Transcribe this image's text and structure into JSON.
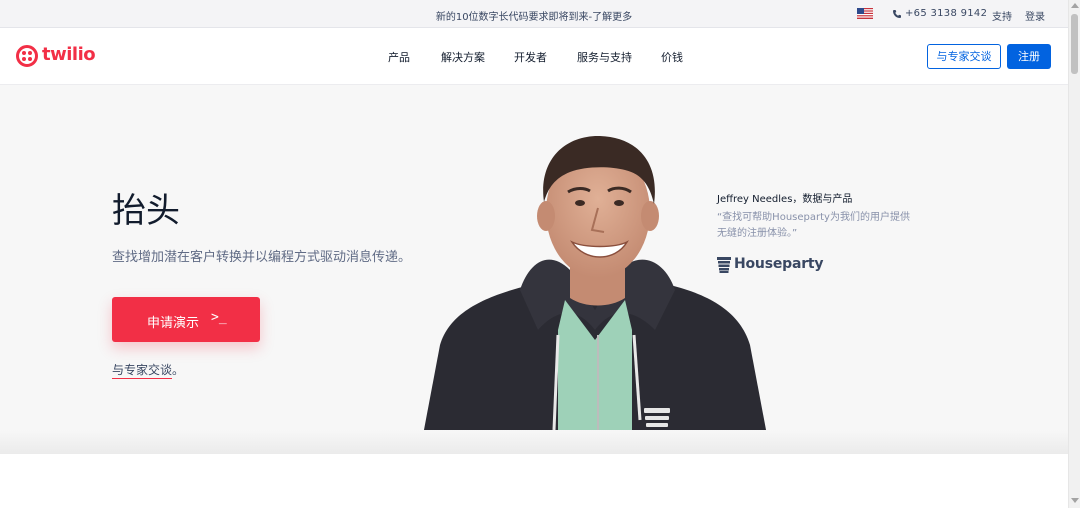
{
  "topbar": {
    "announcement": "新的10位数字长代码要求即将到来-了解更多",
    "flag_icon": "us-flag-icon",
    "phone_icon": "phone-icon",
    "phone": "+65 3138 9142",
    "support": "支持",
    "login": "登录"
  },
  "navbar": {
    "logo_text": "twilio",
    "links": [
      "产品",
      "解决方案",
      "开发者",
      "服务与支持",
      "价钱"
    ],
    "talk_to_expert": "与专家交谈",
    "signup": "注册"
  },
  "hero": {
    "title": "抬头",
    "subtitle": "查找增加潜在客户转换并以编程方式驱动消息传递。",
    "demo_button": "申请演示",
    "demo_button_cursor": ">_",
    "expert_link": "与专家交谈",
    "expert_link_suffix": "。"
  },
  "testimonial": {
    "name": "Jeffrey Needles，数据与产品",
    "quote": "“查找可帮助Houseparty为我们的用户提供无缝的注册体验。”",
    "company_logo": "Houseparty"
  },
  "colors": {
    "brand_red": "#f22f46",
    "primary_blue": "#0263e0",
    "text_dark": "#121c2d",
    "text_muted": "#606b85"
  }
}
